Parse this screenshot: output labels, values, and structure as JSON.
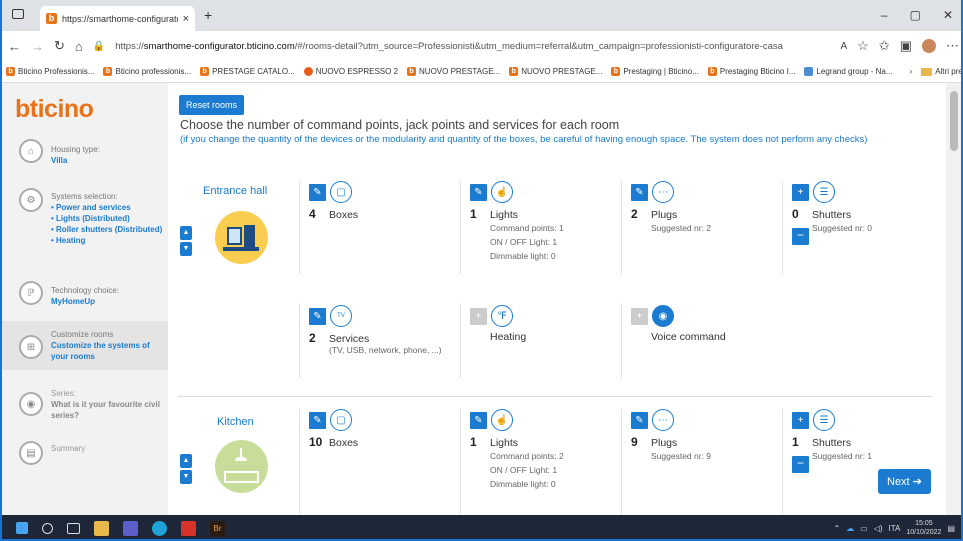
{
  "browser": {
    "tab_title": "https://smarthome-configurator",
    "close": "×",
    "newtab": "+",
    "win": {
      "min": "–",
      "max": "▢",
      "close": "✕"
    },
    "url_prefix": "https://",
    "url_host": "smarthome-configurator.bticino.com",
    "url_path": "/#/rooms-detail?utm_source=Professionisti&utm_medium=referral&utm_campaign=professionisti-configuratore-casa",
    "bookmarks": [
      "Bticino Professionis...",
      "Bticino professionis...",
      "PRESTAGE CATALO...",
      "NUOVO ESPRESSO 2",
      "NUOVO PRESTAGE...",
      "NUOVO PRESTAGE...",
      "Prestaging | Bticino...",
      "Prestaging Bticino I...",
      "Legrand group - Na..."
    ],
    "other_favorites": "Altri preferiti"
  },
  "sidebar": {
    "logo_prefix": "b",
    "logo_rest": "ticino",
    "steps": [
      {
        "title": "Housing type:",
        "value": "Villa"
      },
      {
        "title": "Systems selection:",
        "items": [
          "Power and services",
          "Lights (Distributed)",
          "Roller shutters (Distributed)",
          "Heating"
        ]
      },
      {
        "title": "Technology choice:",
        "value": "MyHomeUp"
      },
      {
        "title": "Customize rooms",
        "value": "Customize the systems of your rooms"
      },
      {
        "title": "Series:",
        "value": "What is it your favourite civil series?"
      },
      {
        "title": "Summary"
      }
    ]
  },
  "main": {
    "reset_label": "Reset rooms",
    "heading": "Choose the number of command points, jack points and services for each room",
    "subtext": "(if you change the quantity of the devices or the modularity and quantity of the boxes, be careful of having enough space. The system does not perform any checks)",
    "next_label": "Next"
  },
  "rooms": [
    {
      "name": "Entrance hall",
      "boxes": {
        "n": "4",
        "label": "Boxes"
      },
      "lights": {
        "n": "1",
        "label": "Lights",
        "d1": "Command points: 1",
        "d2": "ON / OFF Light: 1",
        "d3": "Dimmable light: 0"
      },
      "plugs": {
        "n": "2",
        "label": "Plugs",
        "d1": "Suggested nr: 2"
      },
      "shutters": {
        "n": "0",
        "label": "Shutters",
        "d1": "Suggested nr: 0"
      },
      "services": {
        "n": "2",
        "label": "Services",
        "d1": "(TV, USB, network, phone, ...)"
      },
      "heating": {
        "label": "Heating"
      },
      "voice": {
        "label": "Voice command"
      }
    },
    {
      "name": "Kitchen",
      "boxes": {
        "n": "10",
        "label": "Boxes"
      },
      "lights": {
        "n": "1",
        "label": "Lights",
        "d1": "Command points: 2",
        "d2": "ON / OFF Light: 1",
        "d3": "Dimmable light: 0"
      },
      "plugs": {
        "n": "9",
        "label": "Plugs",
        "d1": "Suggested nr: 9"
      },
      "shutters": {
        "n": "1",
        "label": "Shutters",
        "d1": "Suggested nr: 1"
      }
    }
  ],
  "taskbar": {
    "lang": "ITA",
    "time": "15:05",
    "date": "10/10/2022"
  }
}
